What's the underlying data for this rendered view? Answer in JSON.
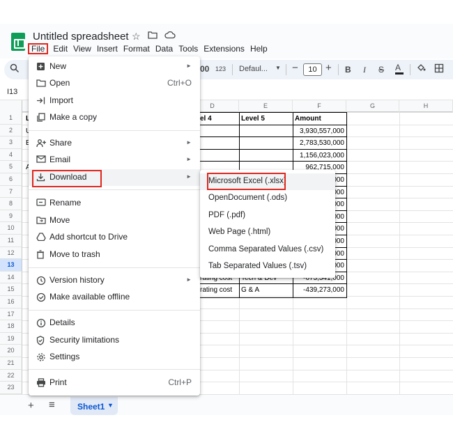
{
  "header": {
    "doc_title": "Untitled spreadsheet",
    "menus": [
      "File",
      "Edit",
      "View",
      "Insert",
      "Format",
      "Data",
      "Tools",
      "Extensions",
      "Help"
    ]
  },
  "toolbar": {
    "number_format": "123",
    "font": "Defaul...",
    "font_size": "10",
    "decrease_decimal_label": "00"
  },
  "formula_bar": {
    "cell_ref": "I13"
  },
  "grid": {
    "columns": [
      "D",
      "E",
      "F",
      "G",
      "H"
    ],
    "rows": [
      "1",
      "2",
      "3",
      "4",
      "5",
      "6",
      "7",
      "8",
      "9",
      "10",
      "11",
      "12",
      "13",
      "14",
      "15",
      "16",
      "17",
      "18",
      "19",
      "20",
      "21",
      "22",
      "23"
    ],
    "selected_row": "13",
    "header_cells": {
      "a1_partial": "L",
      "d1": "el 4",
      "e1": "Level 5",
      "f1": "Amount"
    },
    "col_a_partial": [
      "U",
      "E",
      "",
      "A"
    ],
    "amounts": [
      "3,930,557,000",
      "2,783,530,000",
      "1,156,023,000",
      "962,715,000",
      "000",
      "000",
      "000",
      "000",
      "000",
      "000",
      "000",
      "000",
      "-673,341,000",
      "-439,273,000"
    ],
    "row14": {
      "d": "rating cost",
      "e": "Tech & Dev"
    },
    "row15": {
      "d": "rating cost",
      "e": "G & A"
    }
  },
  "file_menu": {
    "items": [
      {
        "label": "New",
        "icon": "new-icon",
        "arrow": true
      },
      {
        "label": "Open",
        "icon": "folder-icon",
        "shortcut": "Ctrl+O"
      },
      {
        "label": "Import",
        "icon": "import-icon"
      },
      {
        "label": "Make a copy",
        "icon": "copy-icon"
      },
      {
        "label": "Share",
        "icon": "share-icon",
        "arrow": true
      },
      {
        "label": "Email",
        "icon": "email-icon",
        "arrow": true
      },
      {
        "label": "Download",
        "icon": "download-icon",
        "arrow": true
      },
      {
        "label": "Rename",
        "icon": "rename-icon"
      },
      {
        "label": "Move",
        "icon": "move-icon"
      },
      {
        "label": "Add shortcut to Drive",
        "icon": "drive-shortcut-icon"
      },
      {
        "label": "Move to trash",
        "icon": "trash-icon"
      },
      {
        "label": "Version history",
        "icon": "history-icon",
        "arrow": true
      },
      {
        "label": "Make available offline",
        "icon": "offline-icon"
      },
      {
        "label": "Details",
        "icon": "info-icon"
      },
      {
        "label": "Security limitations",
        "icon": "shield-icon"
      },
      {
        "label": "Settings",
        "icon": "gear-icon"
      },
      {
        "label": "Print",
        "icon": "print-icon",
        "shortcut": "Ctrl+P"
      }
    ]
  },
  "download_submenu": {
    "items": [
      "Microsoft Excel (.xlsx)",
      "OpenDocument (.ods)",
      "PDF (.pdf)",
      "Web Page (.html)",
      "Comma Separated Values (.csv)",
      "Tab Separated Values (.tsv)"
    ]
  },
  "sheets": {
    "active_tab": "Sheet1"
  },
  "colors": {
    "highlight_border": "#e0261e",
    "sheets_green": "#0f9d58",
    "accent_blue": "#0b57d0"
  }
}
